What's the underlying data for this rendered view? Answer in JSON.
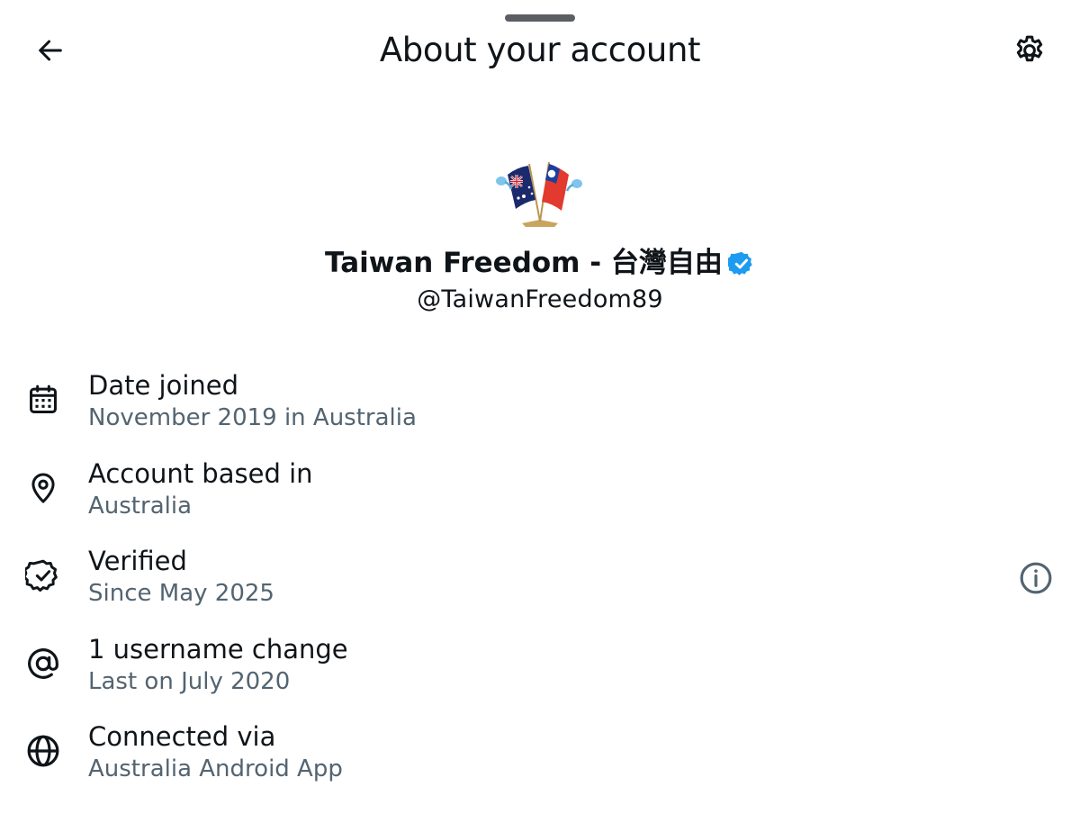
{
  "header": {
    "title": "About your account",
    "back_icon": "arrow-left-icon",
    "settings_icon": "gear-icon"
  },
  "profile": {
    "avatar_description_icon": "flags-icon",
    "display_name": "Taiwan Freedom - 台灣自由",
    "handle": "@TaiwanFreedom89",
    "verified": true,
    "verified_color": "#1d9bf0"
  },
  "details": [
    {
      "icon": "calendar-icon",
      "title": "Date joined",
      "subtitle": "November 2019 in Australia"
    },
    {
      "icon": "location-pin-icon",
      "title": "Account based in",
      "subtitle": "Australia"
    },
    {
      "icon": "verified-check-icon",
      "title": "Verified",
      "subtitle": "Since May 2025",
      "has_info": true
    },
    {
      "icon": "at-sign-icon",
      "title": "1 username change",
      "subtitle": "Last on July 2020"
    },
    {
      "icon": "globe-icon",
      "title": "Connected via",
      "subtitle": "Australia Android App"
    }
  ],
  "colors": {
    "primary_text": "#0f1419",
    "secondary_text": "#536471",
    "icon": "#0f1419",
    "info_icon": "#536471"
  }
}
